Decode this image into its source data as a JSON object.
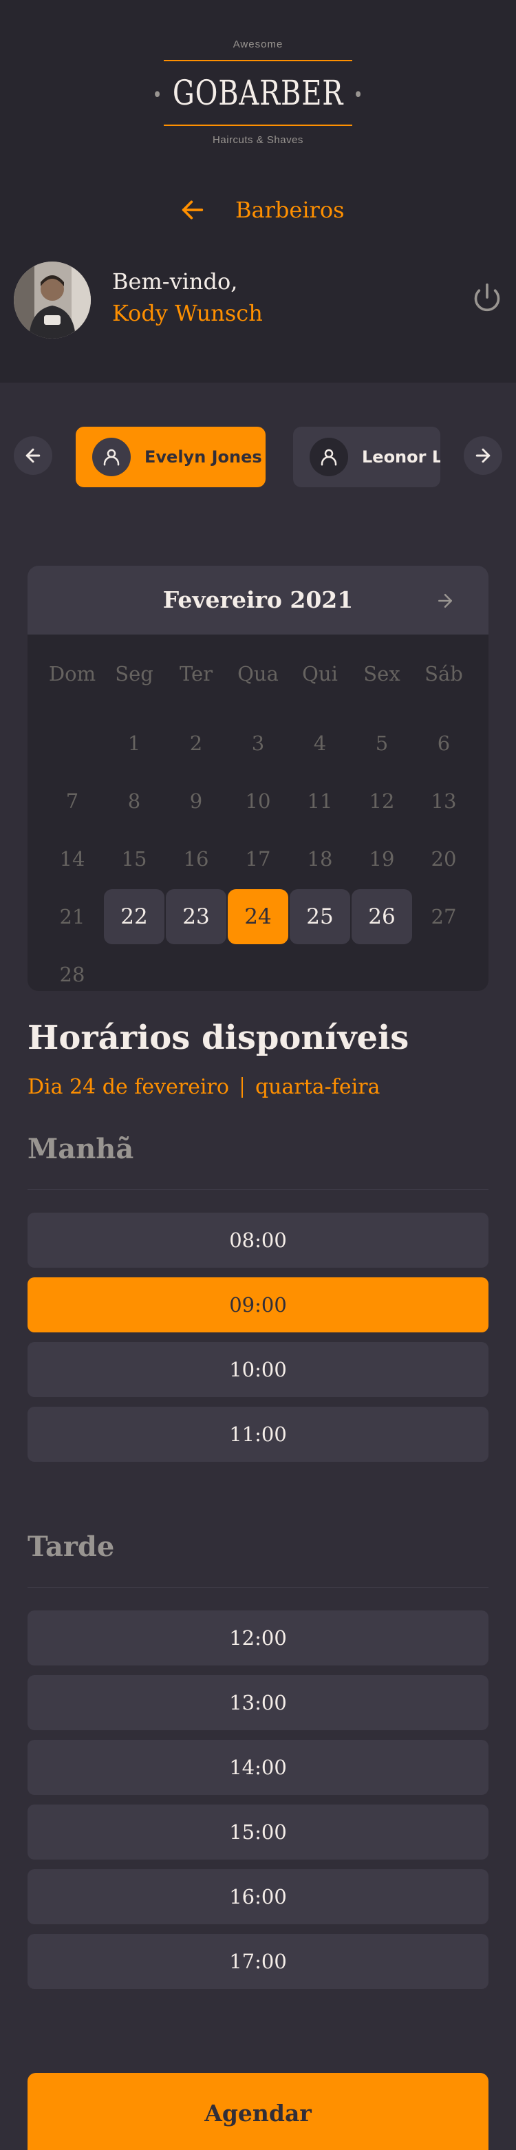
{
  "logo": {
    "top_text": "Awesome",
    "main_text": "GOBARBER",
    "bottom_text": "Haircuts & Shaves"
  },
  "nav": {
    "back_icon": "arrow-left-icon",
    "title": "Barbeiros"
  },
  "profile": {
    "greeting": "Bem-vindo,",
    "user_name": "Kody Wunsch",
    "logout_icon": "power-icon"
  },
  "providers": {
    "prev_icon": "arrow-left-icon",
    "next_icon": "arrow-right-icon",
    "items": [
      {
        "name": "Evelyn Jones",
        "selected": true
      },
      {
        "name": "Leonor Lo",
        "selected": false
      }
    ]
  },
  "calendar": {
    "month_label": "Fevereiro 2021",
    "next_icon": "arrow-right-icon",
    "weekdays": [
      "Dom",
      "Seg",
      "Ter",
      "Qua",
      "Qui",
      "Sex",
      "Sáb"
    ],
    "weeks": [
      [
        "",
        "1",
        "2",
        "3",
        "4",
        "5",
        "6"
      ],
      [
        "7",
        "8",
        "9",
        "10",
        "11",
        "12",
        "13"
      ],
      [
        "14",
        "15",
        "16",
        "17",
        "18",
        "19",
        "20"
      ],
      [
        "21",
        "22",
        "23",
        "24",
        "25",
        "26",
        "27"
      ],
      [
        "28",
        "",
        "",
        "",
        "",
        "",
        ""
      ]
    ],
    "available_days": [
      "22",
      "23",
      "24",
      "25",
      "26"
    ],
    "selected_day": "24"
  },
  "schedule": {
    "title": "Horários disponíveis",
    "date_label": "Dia 24 de fevereiro",
    "weekday_label": "quarta-feira",
    "morning": {
      "title": "Manhã",
      "slots": [
        "08:00",
        "09:00",
        "10:00",
        "11:00"
      ]
    },
    "afternoon": {
      "title": "Tarde",
      "slots": [
        "12:00",
        "13:00",
        "14:00",
        "15:00",
        "16:00",
        "17:00"
      ]
    },
    "selected_slot": "09:00"
  },
  "cta": {
    "label": "Agendar"
  },
  "colors": {
    "accent": "#ff9000",
    "background": "#312e38",
    "header": "#28262e",
    "surface": "#3e3b47",
    "text": "#f4ede8",
    "muted": "#999591"
  }
}
